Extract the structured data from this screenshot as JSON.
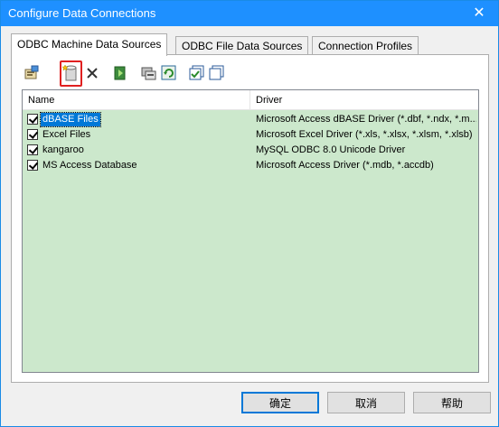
{
  "window": {
    "title": "Configure Data Connections",
    "close_glyph": "✕"
  },
  "tabs": [
    {
      "label": "ODBC Machine Data Sources",
      "active": true
    },
    {
      "label": "ODBC File Data Sources",
      "active": false
    },
    {
      "label": "Connection Profiles",
      "active": false
    }
  ],
  "toolbar": {
    "buttons": [
      {
        "icon": "properties-icon"
      },
      {
        "icon": "new-data-source-icon"
      },
      {
        "icon": "delete-icon"
      },
      {
        "icon": "test-connection-icon"
      },
      {
        "icon": "configure-icon"
      },
      {
        "icon": "refresh-icon"
      },
      {
        "icon": "check-all-icon"
      },
      {
        "icon": "copy-icon"
      }
    ]
  },
  "list": {
    "columns": [
      "Name",
      "Driver"
    ],
    "rows": [
      {
        "name": "dBASE Files",
        "driver": "Microsoft Access dBASE Driver (*.dbf, *.ndx, *.m...",
        "checked": true,
        "selected": true
      },
      {
        "name": "Excel Files",
        "driver": "Microsoft Excel Driver (*.xls, *.xlsx, *.xlsm, *.xlsb)",
        "checked": true,
        "selected": false
      },
      {
        "name": "kangaroo",
        "driver": "MySQL ODBC 8.0 Unicode Driver",
        "checked": true,
        "selected": false
      },
      {
        "name": "MS Access Database",
        "driver": "Microsoft Access Driver (*.mdb, *.accdb)",
        "checked": true,
        "selected": false
      }
    ],
    "background_color": "#cce8cc"
  },
  "buttons": {
    "ok": "确定",
    "cancel": "取消",
    "help": "帮助"
  },
  "colors": {
    "titlebar": "#1e90ff",
    "selection": "#0078d7",
    "highlight": "#e02020"
  }
}
